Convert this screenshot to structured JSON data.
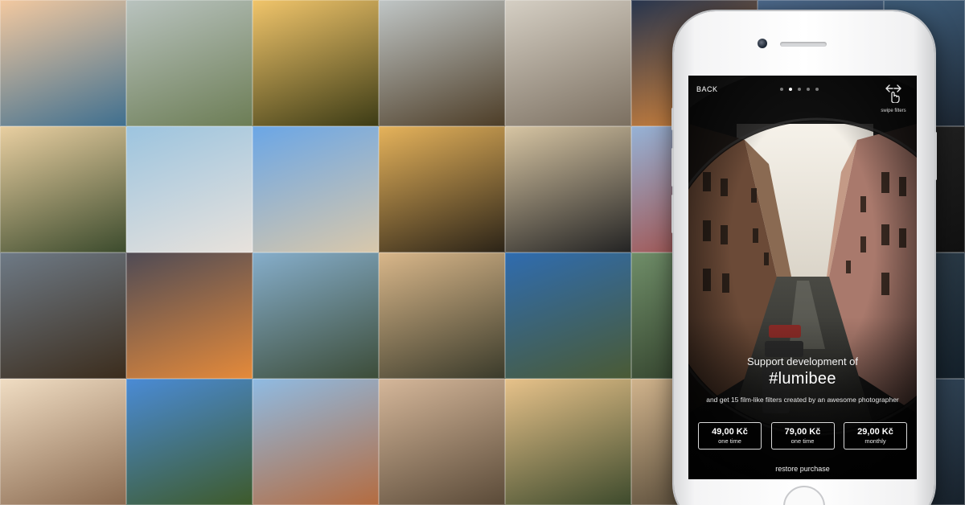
{
  "ad": {
    "phone_screen": {
      "back_label": "BACK",
      "pager": {
        "total": 5,
        "active": 1
      },
      "swipe_hint": "swipe filters",
      "promo_title": "Support development of",
      "promo_hashtag": "#lumibee",
      "promo_subtitle": "and get 15 film-like filters created by an awesome photographer",
      "prices": [
        {
          "amount": "49,00 Kč",
          "period": "one time"
        },
        {
          "amount": "79,00 Kč",
          "period": "one time"
        },
        {
          "amount": "29,00 Kč",
          "period": "monthly"
        }
      ],
      "restore_label": "restore purchase"
    },
    "background_tiles": [
      {
        "subject": "woman-on-rocks-by-sea",
        "colors": [
          "#f3c9a0",
          "#3f6f8f"
        ]
      },
      {
        "subject": "woman-on-cliff",
        "colors": [
          "#b9c3bf",
          "#6c7d55"
        ]
      },
      {
        "subject": "dandelion-sunset",
        "colors": [
          "#f1c56b",
          "#3c3b15"
        ]
      },
      {
        "subject": "rock-formations",
        "colors": [
          "#c0c6c6",
          "#4d3d27"
        ]
      },
      {
        "subject": "street-walkers",
        "colors": [
          "#d5cfc4",
          "#7b6f60"
        ]
      },
      {
        "subject": "blue-sky-sunset",
        "colors": [
          "#27354e",
          "#e28b3a"
        ]
      },
      {
        "subject": "blue-sky-cut",
        "colors": [
          "#4f6c8f",
          "#1f3244"
        ]
      },
      {
        "subject": "bridge-cut",
        "colors": [
          "#3f5e7b",
          "#1c2632"
        ]
      },
      {
        "subject": "forest-sunset",
        "colors": [
          "#e9cfa1",
          "#3c4b2d"
        ]
      },
      {
        "subject": "friends-in-boat",
        "colors": [
          "#9cc4df",
          "#e8e2dc"
        ]
      },
      {
        "subject": "beach-cyclist",
        "colors": [
          "#6aa6e6",
          "#d9c8ab"
        ]
      },
      {
        "subject": "palm-sunset",
        "colors": [
          "#e6b35b",
          "#2b2317"
        ]
      },
      {
        "subject": "silhouette-at-sea",
        "colors": [
          "#d7c5a3",
          "#232323"
        ]
      },
      {
        "subject": "blue-window-building",
        "colors": [
          "#95b2d6",
          "#a4483f"
        ]
      },
      {
        "subject": "peacock-cut",
        "colors": [
          "#1a2f2d",
          "#2f7a6f"
        ]
      },
      {
        "subject": "empty",
        "colors": [
          "#222222",
          "#111111"
        ]
      },
      {
        "subject": "rocky-dusk",
        "colors": [
          "#6e7a86",
          "#3b2c1c"
        ]
      },
      {
        "subject": "orange-dusk",
        "colors": [
          "#4f4b55",
          "#e58a3a"
        ]
      },
      {
        "subject": "mountain-lake-boat",
        "colors": [
          "#86aecb",
          "#3c4c38"
        ]
      },
      {
        "subject": "forest-woman",
        "colors": [
          "#d9b78a",
          "#3a3a2a"
        ]
      },
      {
        "subject": "rock-pillars",
        "colors": [
          "#2f6cb0",
          "#4a5a34"
        ]
      },
      {
        "subject": "green-forest-cut",
        "colors": [
          "#6f8d68",
          "#2d3b27"
        ]
      },
      {
        "subject": "dark-cut",
        "colors": [
          "#3b4b5b",
          "#1b2430"
        ]
      },
      {
        "subject": "dark-cut-2",
        "colors": [
          "#2d3d4a",
          "#14202a"
        ]
      },
      {
        "subject": "ice-cream-woman",
        "colors": [
          "#f0ddc3",
          "#8a6a50"
        ]
      },
      {
        "subject": "sandstone-towers",
        "colors": [
          "#4a8bd6",
          "#3e5a2a"
        ]
      },
      {
        "subject": "nyhavn-harbour",
        "colors": [
          "#8fbbe3",
          "#b46b3f"
        ]
      },
      {
        "subject": "woman-on-rock",
        "colors": [
          "#d5b79a",
          "#5a4a38"
        ]
      },
      {
        "subject": "rainbow-valley",
        "colors": [
          "#e7c28a",
          "#3d4a2c"
        ]
      },
      {
        "subject": "cliff-cut",
        "colors": [
          "#d0b38c",
          "#4b4030"
        ]
      },
      {
        "subject": "harbor-cut",
        "colors": [
          "#415566",
          "#1d2833"
        ]
      },
      {
        "subject": "harbor-cut-2",
        "colors": [
          "#33475a",
          "#18222c"
        ]
      }
    ]
  }
}
